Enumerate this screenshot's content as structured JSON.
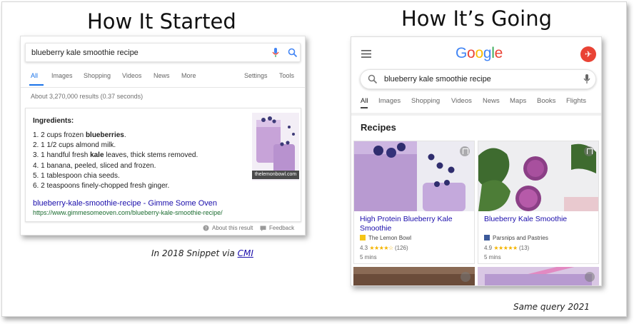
{
  "titles": {
    "left": "How It Started",
    "right": "How It’s Going"
  },
  "captions": {
    "left_prefix": "In 2018 Snippet via ",
    "left_link": "CMI",
    "right": "Same query 2021"
  },
  "old_serp": {
    "query": "blueberry kale smoothie recipe",
    "tabs": [
      "All",
      "Images",
      "Shopping",
      "Videos",
      "News",
      "More"
    ],
    "tools": [
      "Settings",
      "Tools"
    ],
    "result_count": "About 3,270,000 results (0.37 seconds)",
    "snippet": {
      "heading": "Ingredients:",
      "items": [
        {
          "pre": "1. 2 cups frozen ",
          "bold": "blueberries",
          "post": "."
        },
        {
          "pre": "2. 1 1/2 cups almond milk.",
          "bold": "",
          "post": ""
        },
        {
          "pre": "3. 1 handful fresh ",
          "bold": "kale",
          "post": " leaves, thick stems removed."
        },
        {
          "pre": "4. 1 banana, peeled, sliced and frozen.",
          "bold": "",
          "post": ""
        },
        {
          "pre": "5. 1 tablespoon chia seeds.",
          "bold": "",
          "post": ""
        },
        {
          "pre": "6. 2 teaspoons finely-chopped fresh ginger.",
          "bold": "",
          "post": ""
        }
      ],
      "image_label": "thelemonbowl.com",
      "link_title": "blueberry-kale-smoothie-recipe - Gimme Some Oven",
      "url": "https://www.gimmesomeoven.com/blueberry-kale-smoothie-recipe/"
    },
    "footer": {
      "about": "About this result",
      "feedback": "Feedback"
    }
  },
  "new_serp": {
    "logo": "Google",
    "query": "blueberry kale smoothie recipe",
    "tabs": [
      "All",
      "Images",
      "Shopping",
      "Videos",
      "News",
      "Maps",
      "Books",
      "Flights"
    ],
    "section_title": "Recipes",
    "cards": [
      {
        "title": "High Protein Blueberry Kale Smoothie",
        "source": "The Lemon Bowl",
        "rating": "4.3",
        "stars": "★★★★☆",
        "reviews": "(126)",
        "time": "5 mins"
      },
      {
        "title": "Blueberry Kale Smoothie",
        "source": "Parsnips and Pastries",
        "rating": "4.9",
        "stars": "★★★★★",
        "reviews": "(13)",
        "time": "5 mins"
      }
    ]
  },
  "colors": {
    "link_blue": "#1a0dab",
    "url_green": "#1a6b2f",
    "star_gold": "#f4b400",
    "avatar_red": "#e94335",
    "tab_blue": "#1a73e8"
  }
}
